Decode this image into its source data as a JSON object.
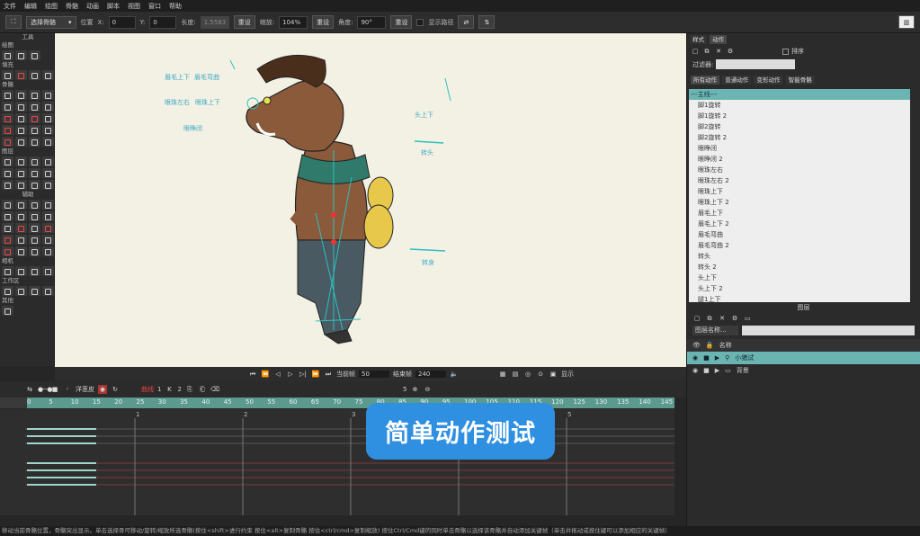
{
  "menu": [
    "文件",
    "编辑",
    "绘图",
    "骨骼",
    "动画",
    "脚本",
    "视图",
    "窗口",
    "帮助"
  ],
  "toolbar": {
    "tool_name": "选择骨骼",
    "position_label": "位置",
    "x_label": "X:",
    "x_value": "0",
    "y_label": "Y:",
    "y_value": "0",
    "length_label": "长度:",
    "length_value": "1.5583",
    "reset1": "重设",
    "scale_label": "缩放:",
    "scale_value": "104%",
    "reset2": "重设",
    "angle_label": "角度:",
    "angle_value": "90°",
    "reset3": "重设",
    "show_path": "显示路径"
  },
  "tools": {
    "sections": [
      "工具",
      "绘图",
      "填充",
      "骨骼",
      "图层",
      "相机",
      "工作区",
      "其他"
    ],
    "aux_label": "辅助"
  },
  "canvas": {
    "annotations": [
      "眉毛上下",
      "眉毛弯曲",
      "眼珠左右",
      "眼珠上下",
      "眼睁闭",
      "头上下",
      "转头",
      "转身"
    ]
  },
  "playback": {
    "current_frame_label": "当前帧",
    "current_frame": "50",
    "end_frame_label": "结束帧",
    "end_frame": "240",
    "display": "显示"
  },
  "timeline": {
    "onion": "洋葱皮",
    "curve": "曲线",
    "value_1": "1",
    "value_2": "2",
    "zoom": "5",
    "frame_ticks": [
      "0",
      "5",
      "10",
      "15",
      "20",
      "25",
      "30",
      "35",
      "40",
      "45",
      "50",
      "55",
      "60",
      "65",
      "70",
      "75",
      "80",
      "85",
      "90",
      "95",
      "100",
      "105",
      "110",
      "115",
      "120",
      "125",
      "130",
      "135",
      "140",
      "145"
    ],
    "seconds": [
      "1",
      "2",
      "3",
      "4",
      "5"
    ]
  },
  "right_panel": {
    "tabs": [
      "样式",
      "动作"
    ],
    "sort_label": "排序",
    "filter_label": "过滤器:",
    "action_tabs": [
      "所有动作",
      "普通动作",
      "变形动作",
      "智能骨骼"
    ],
    "actions": [
      "---主线---",
      "脚1旋转",
      "脚1旋转 2",
      "脚2旋转",
      "脚2旋转 2",
      "眼睁闭",
      "眼睁闭 2",
      "眼珠左右",
      "眼珠左右 2",
      "眼珠上下",
      "眼珠上下 2",
      "眉毛上下",
      "眉毛上下 2",
      "眉毛弯曲",
      "眉毛弯曲 2",
      "转头",
      "转头 2",
      "头上下",
      "头上下 2",
      "腿1上下"
    ]
  },
  "layers": {
    "title": "图层",
    "search_placeholder": "图层名称...",
    "name_header": "名称",
    "items": [
      "小猪试",
      "背景"
    ]
  },
  "overlay_title": "简单动作测试",
  "status_text": "移动当前骨骼位置，骨骼突出显示。单击选择骨可移动/旋转/缩放所选骨骼(按住<shift>进行约束 按住<alt>复制骨骼 按住<ctrl/cmd>复制缩放) 按住Ctrl/Cmd键的同时单击骨骼以选择该骨骼并自动添加关键帧（单击并拖动或按住键可以添加相应的关键帧）"
}
